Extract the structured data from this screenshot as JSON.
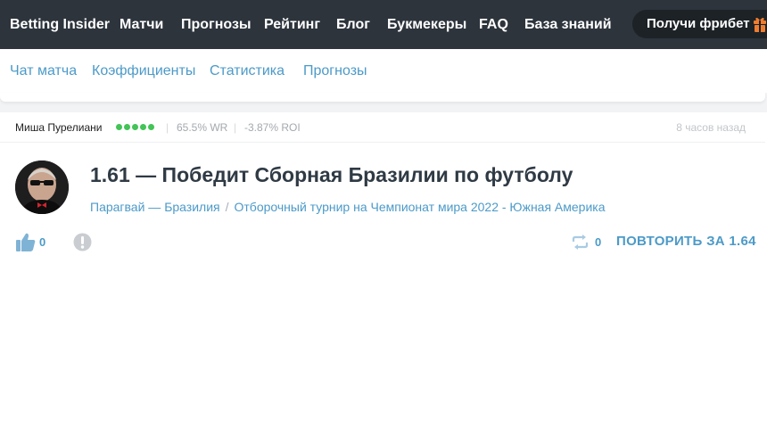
{
  "topnav": {
    "brand": "Betting Insider",
    "items": [
      "Матчи",
      "Прогнозы",
      "Рейтинг",
      "Блог",
      "Букмекеры",
      "FAQ",
      "База знаний"
    ],
    "freebet_label": "Получи фрибет"
  },
  "subnav": {
    "tabs": [
      "Чат матча",
      "Коэффициенты",
      "Статистика",
      "Прогнозы"
    ]
  },
  "card": {
    "author": "Миша Пурелиани",
    "rating_dots": 5,
    "win_rate": "65.5% WR",
    "roi": "-3.87% ROI",
    "time_ago": "8 часов назад",
    "title": "1.61 — Победит Сборная Бразилии по футболу",
    "match_link": "Парагвай — Бразилия",
    "separator": "/",
    "tournament_link": "Отборочный турнир на Чемпионат мира 2022 - Южная Америка",
    "likes": "0",
    "repeats": "0",
    "repeat_button": "ПОВТОРИТЬ ЗА 1.64"
  },
  "colors": {
    "nav_bg": "#2d343c",
    "accent_blue": "#4c9ac8",
    "rating_green": "#42c456",
    "gift_orange": "#f07d2e"
  },
  "icons": [
    "thumbs-up-icon",
    "report-icon",
    "repeat-icon",
    "gift-icon"
  ]
}
